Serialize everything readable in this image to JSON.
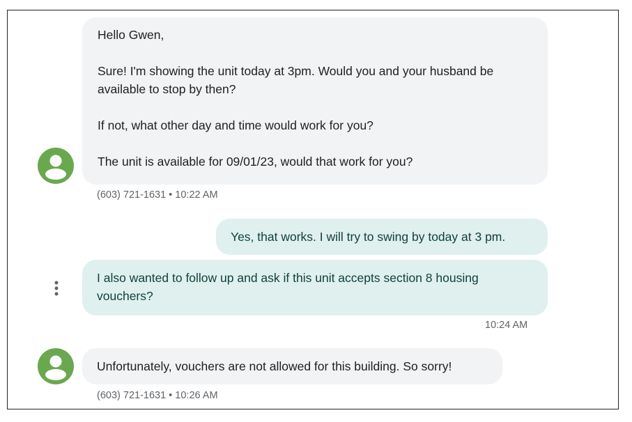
{
  "conversation": {
    "messages": [
      {
        "direction": "incoming",
        "paragraphs": [
          "Hello Gwen,",
          "Sure! I'm showing the unit today at 3pm. Would you and your husband be available to stop by then?",
          "If not, what other day and time would work for you?",
          "The unit is available for 09/01/23, would that work for you?"
        ],
        "sender": "(603) 721-1631",
        "time": "10:22 AM",
        "meta": "(603) 721-1631 • 10:22 AM"
      },
      {
        "direction": "outgoing",
        "text": "Yes, that works. I will try to swing by today at 3 pm."
      },
      {
        "direction": "outgoing",
        "text": "I also wanted to follow up and ask if this unit accepts section 8 housing vouchers?",
        "time": "10:24 AM"
      },
      {
        "direction": "incoming",
        "text": "Unfortunately, vouchers are not allowed for this building. So sorry!",
        "sender": "(603) 721-1631",
        "time": "10:26 AM",
        "meta": "(603) 721-1631 • 10:26 AM"
      }
    ]
  },
  "icons": {
    "avatar": "person-avatar-icon",
    "more": "more-vert-icon"
  },
  "colors": {
    "avatar_bg": "#6aa84f",
    "incoming_bubble": "#f1f3f4",
    "outgoing_bubble": "#dff0ef",
    "outgoing_text": "#0f3f3c"
  }
}
